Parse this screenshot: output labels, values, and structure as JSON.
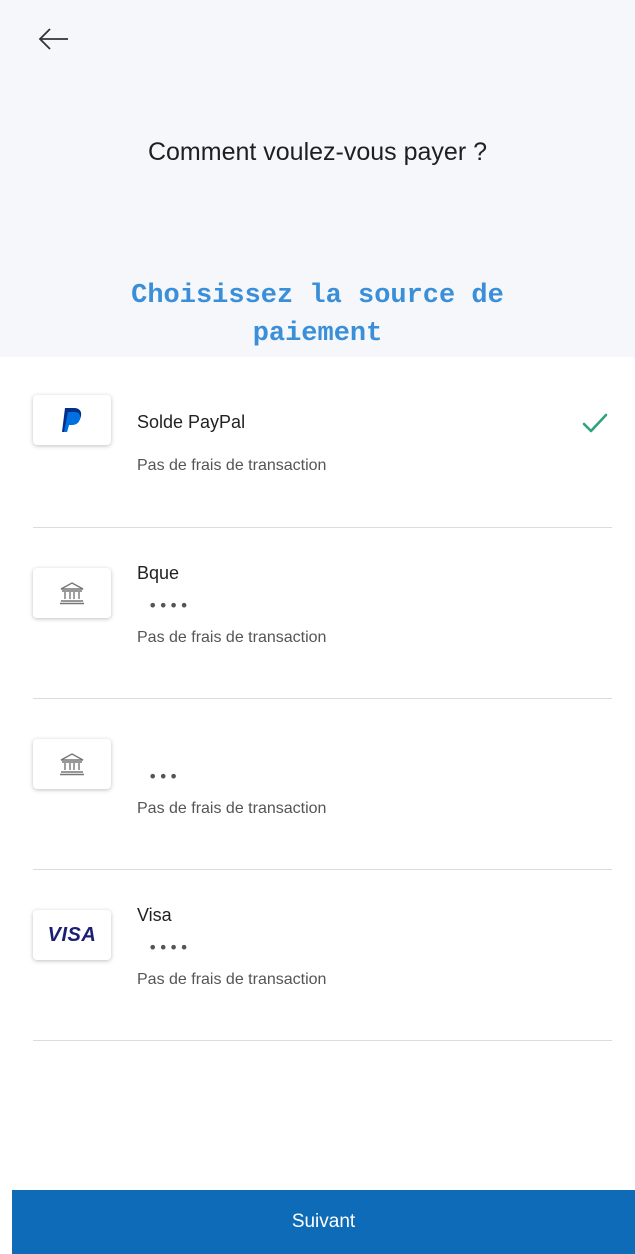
{
  "header": {
    "title": "Comment voulez-vous payer ?",
    "annotation_line1": "Choisissez la source de",
    "annotation_line2": "paiement"
  },
  "methods": [
    {
      "logo": "paypal-logo",
      "name": "Solde PayPal",
      "masked": "",
      "fee": "Pas de frais de transaction",
      "selected": true
    },
    {
      "logo": "bank-icon",
      "name": "Bque",
      "masked": "••••",
      "fee": "Pas de frais de transaction",
      "selected": false
    },
    {
      "logo": "bank-icon",
      "name": "",
      "masked": "•••",
      "fee": "Pas de frais de transaction",
      "selected": false
    },
    {
      "logo": "visa-logo",
      "logo_text": "VISA",
      "name": "Visa",
      "masked": "••••",
      "fee": "Pas de frais de transaction",
      "selected": false
    }
  ],
  "footer": {
    "next_label": "Suivant"
  },
  "colors": {
    "primary": "#0e6bb8",
    "check": "#2fa37a",
    "annotation": "#3a8fd8",
    "header_bg": "#f5f7fa"
  }
}
